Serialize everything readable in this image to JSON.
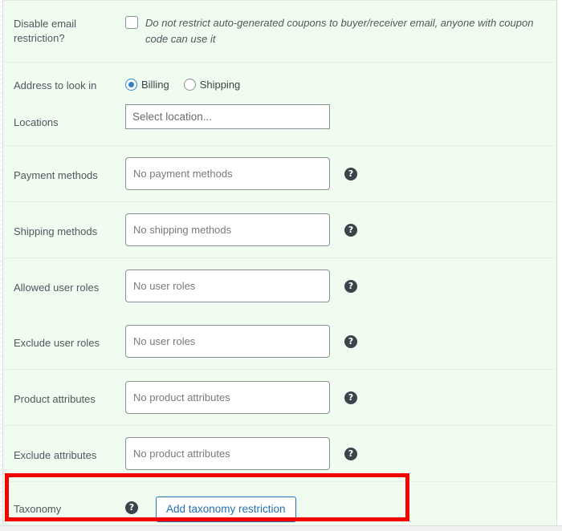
{
  "colors": {
    "panel_background": "#f0fcf0",
    "row_divider": "#e6efe6",
    "label_text": "#50575e",
    "placeholder_text": "#7a7a7a",
    "radio_accent": "#3582c4",
    "button_accent": "#2271b1",
    "highlight": "#f60000",
    "helptip_bg": "#3c434a"
  },
  "rows": {
    "disable_email": {
      "label": "Disable email restriction?",
      "checkbox_checked": false,
      "description": "Do not restrict auto-generated coupons to buyer/receiver email, anyone with coupon code can use it"
    },
    "address": {
      "label": "Address to look in",
      "options": [
        {
          "label": "Billing",
          "checked": true
        },
        {
          "label": "Shipping",
          "checked": false
        }
      ]
    },
    "locations": {
      "label": "Locations",
      "placeholder": "Select location..."
    },
    "payment_methods": {
      "label": "Payment methods",
      "placeholder": "No payment methods",
      "helptip": "help-icon"
    },
    "shipping_methods": {
      "label": "Shipping methods",
      "placeholder": "No shipping methods",
      "helptip": "help-icon"
    },
    "allowed_user_roles": {
      "label": "Allowed user roles",
      "placeholder": "No user roles",
      "helptip": "help-icon"
    },
    "exclude_user_roles": {
      "label": "Exclude user roles",
      "placeholder": "No user roles",
      "helptip": "help-icon"
    },
    "product_attributes": {
      "label": "Product attributes",
      "placeholder": "No product attributes",
      "helptip": "help-icon"
    },
    "exclude_attributes": {
      "label": "Exclude attributes",
      "placeholder": "No product attributes",
      "helptip": "help-icon"
    },
    "taxonomy": {
      "label": "Taxonomy",
      "helptip": "help-icon",
      "button_label": "Add taxonomy restriction"
    }
  },
  "helptip_glyph": "?"
}
